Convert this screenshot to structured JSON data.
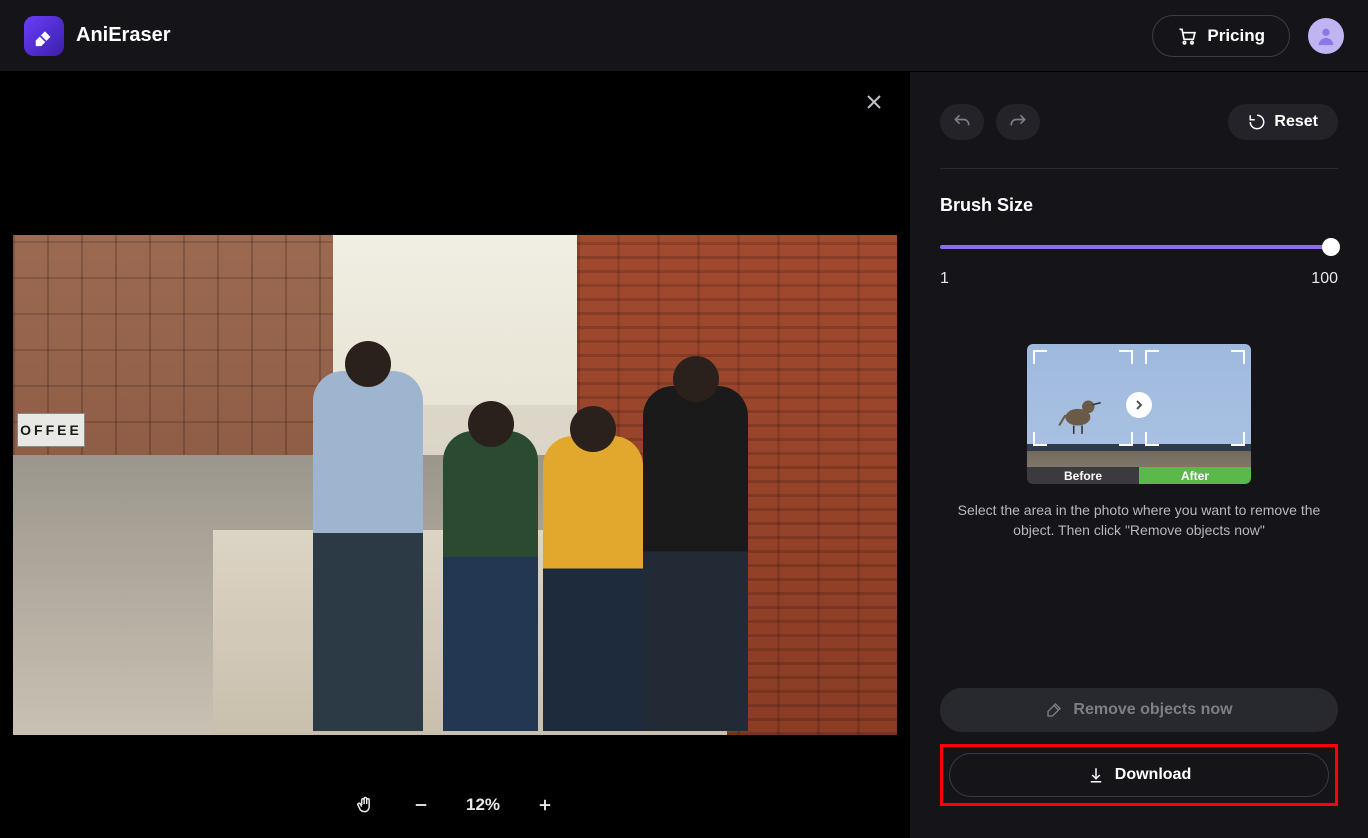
{
  "header": {
    "brand": "AniEraser",
    "pricing_label": "Pricing"
  },
  "canvas": {
    "coffee_sign": "OFFEE",
    "zoom": {
      "value": "12%"
    }
  },
  "sidebar": {
    "reset_label": "Reset",
    "brush_title": "Brush Size",
    "brush_min": "1",
    "brush_max": "100",
    "demo": {
      "before_label": "Before",
      "after_label": "After"
    },
    "instruction": "Select the area in the photo where you want to remove the object. Then click \"Remove objects now\"",
    "remove_label": "Remove objects now",
    "download_label": "Download"
  }
}
